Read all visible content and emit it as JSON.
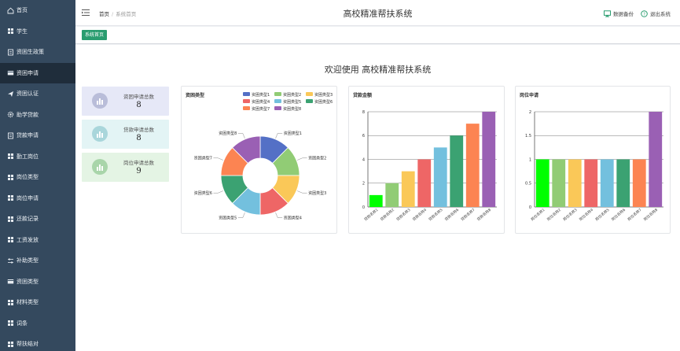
{
  "app": {
    "title": "高校精准帮扶系统"
  },
  "breadcrumb": {
    "home": "首页",
    "separator": "/",
    "current": "系统首页"
  },
  "top_actions": {
    "backup": "数据备份",
    "logout": "退出系统"
  },
  "tabs": [
    {
      "label": "系统首页"
    }
  ],
  "sidebar": {
    "items": [
      {
        "label": "首页",
        "icon": "home-icon"
      },
      {
        "label": "学生",
        "icon": "grid-icon"
      },
      {
        "label": "资困生政策",
        "icon": "doc-icon"
      },
      {
        "label": "资困申请",
        "icon": "card-icon"
      },
      {
        "label": "资困认证",
        "icon": "send-icon"
      },
      {
        "label": "助学贷款",
        "icon": "gear-icon"
      },
      {
        "label": "贷款申请",
        "icon": "doc-icon"
      },
      {
        "label": "勤工岗位",
        "icon": "grid-icon"
      },
      {
        "label": "岗位类型",
        "icon": "grid-icon"
      },
      {
        "label": "岗位申请",
        "icon": "grid-icon"
      },
      {
        "label": "还款记录",
        "icon": "grid-icon"
      },
      {
        "label": "工资发放",
        "icon": "grid-icon"
      },
      {
        "label": "补助类型",
        "icon": "sliders-icon"
      },
      {
        "label": "资困类型",
        "icon": "card-icon"
      },
      {
        "label": "材料类型",
        "icon": "grid-icon"
      },
      {
        "label": "词条",
        "icon": "grid-icon"
      },
      {
        "label": "帮扶结对",
        "icon": "grid-icon"
      }
    ]
  },
  "welcome": "欢迎使用 高校精准帮扶系统",
  "stats": [
    {
      "label": "资困申请总数",
      "value": "8",
      "bg": "#e6e8f7",
      "icon_bg": "#b9bdd9"
    },
    {
      "label": "贷款申请总数",
      "value": "8",
      "bg": "#e3f4f5",
      "icon_bg": "#a9d6db"
    },
    {
      "label": "岗位申请总数",
      "value": "9",
      "bg": "#e4f4e4",
      "icon_bg": "#a9d5aa"
    }
  ],
  "chart_data": [
    {
      "type": "pie",
      "title": "资困类型",
      "categories": [
        "资困类型1",
        "资困类型2",
        "资困类型3",
        "资困类型4",
        "资困类型5",
        "资困类型6",
        "资困类型7",
        "资困类型8"
      ],
      "values": [
        1,
        1,
        1,
        1,
        1,
        1,
        1,
        1
      ],
      "colors": [
        "#5470c6",
        "#91cc75",
        "#fac858",
        "#ee6666",
        "#73c0de",
        "#3ba272",
        "#fc8452",
        "#9a60b4"
      ],
      "donut": true,
      "legend": "top-right"
    },
    {
      "type": "bar",
      "title": "贷款金额",
      "categories": [
        "贷款名称1",
        "贷款名称2",
        "贷款名称3",
        "贷款名称4",
        "贷款名称5",
        "贷款名称6",
        "贷款名称7",
        "贷款名称8"
      ],
      "values": [
        1,
        2,
        3,
        4,
        5,
        6,
        7,
        8
      ],
      "yticks": [
        0,
        2,
        4,
        6,
        8
      ],
      "ylim": [
        0,
        8
      ],
      "colors": [
        "#00ff00",
        "#91cc75",
        "#fac858",
        "#ee6666",
        "#73c0de",
        "#3ba272",
        "#fc8452",
        "#9a60b4"
      ],
      "grid": true
    },
    {
      "type": "bar",
      "title": "岗位申请",
      "categories": [
        "岗位名称1",
        "岗位名称2",
        "岗位名称3",
        "岗位名称4",
        "岗位名称5",
        "岗位名称6",
        "岗位名称7",
        "岗位名称8"
      ],
      "values": [
        1,
        1,
        1,
        1,
        1,
        1,
        1,
        2
      ],
      "yticks": [
        0,
        0.5,
        1,
        1.5,
        2
      ],
      "ylim": [
        0,
        2
      ],
      "colors": [
        "#00ff00",
        "#91cc75",
        "#fac858",
        "#ee6666",
        "#73c0de",
        "#3ba272",
        "#fc8452",
        "#9a60b4"
      ],
      "grid": true
    }
  ]
}
